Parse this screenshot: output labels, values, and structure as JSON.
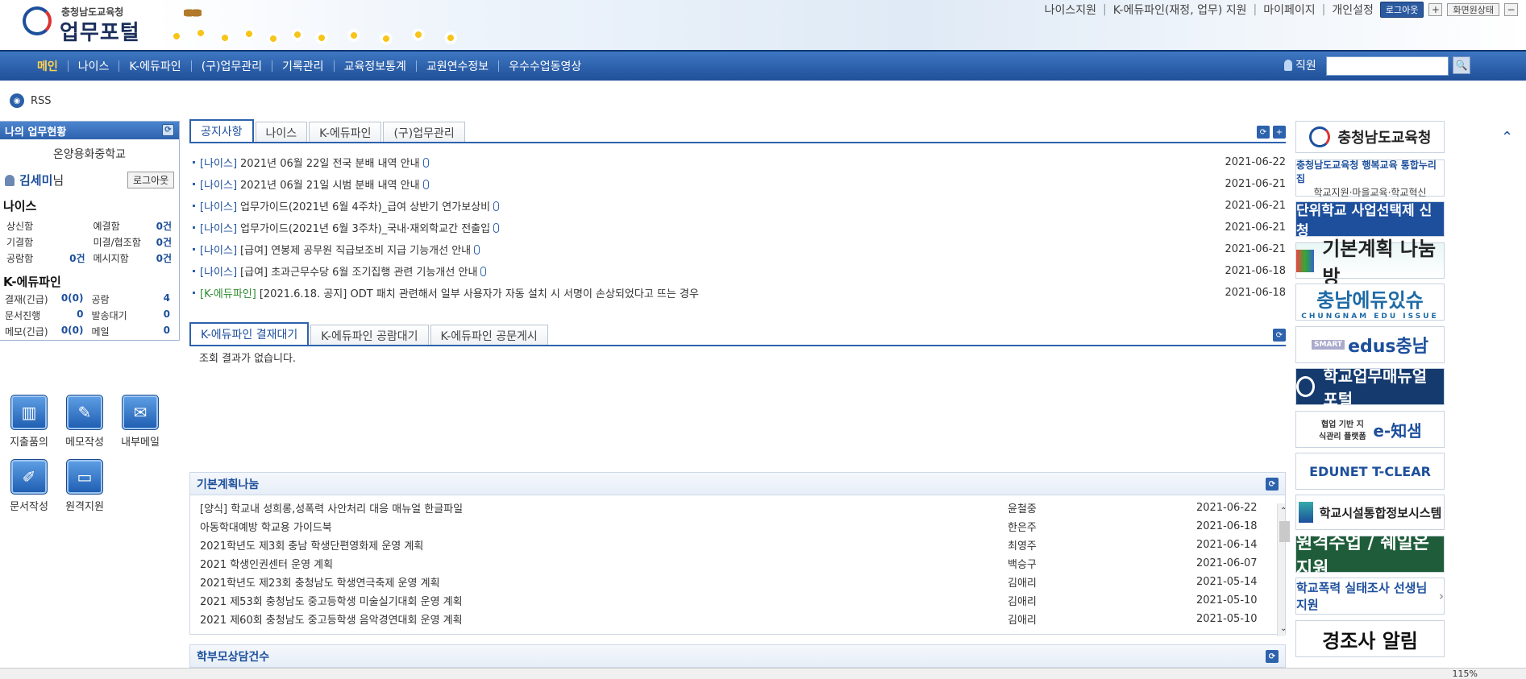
{
  "header": {
    "logo_sub": "충청남도교육청",
    "logo_main": "업무포털",
    "top_links": [
      "나이스지원",
      "K-에듀파인(재정, 업무) 지원",
      "마이페이지",
      "개인설정"
    ],
    "login_button": "로그아웃",
    "plus_button": "+",
    "screen_button": "화면원상태",
    "minus_button": "−"
  },
  "nav": {
    "items": [
      "메인",
      "나이스",
      "K-에듀파인",
      "(구)업무관리",
      "기록관리",
      "교육정보통계",
      "교원연수정보",
      "우수수업동영상"
    ],
    "employee_label": "직원",
    "search_placeholder": "",
    "search_go": "🔍"
  },
  "rss": {
    "label": "RSS"
  },
  "left": {
    "title": "나의 업무현황",
    "school": "온양용화중학교",
    "user_name": "김세미",
    "user_suffix": "님",
    "logout": "로그아웃",
    "neis_title": "나이스",
    "neis_stats": [
      {
        "label": "상신함",
        "value": ""
      },
      {
        "label": "예결함",
        "value": "0건"
      },
      {
        "label": "기결함",
        "value": ""
      },
      {
        "label": "미결/협조함",
        "value": "0건"
      },
      {
        "label": "공람함",
        "value": "0건"
      },
      {
        "label": "메시지함",
        "value": "0건"
      }
    ],
    "edufine_title": "K-에듀파인",
    "edufine_stats": [
      {
        "label": "결재(긴급)",
        "value": "0(0)"
      },
      {
        "label": "공람",
        "value": "4"
      },
      {
        "label": "문서진행",
        "value": "0"
      },
      {
        "label": "발송대기",
        "value": "0"
      },
      {
        "label": "메모(긴급)",
        "value": "0(0)"
      },
      {
        "label": "메일",
        "value": "0"
      }
    ],
    "quick_icons": [
      {
        "label": "지출품의",
        "icon": "chart-icon"
      },
      {
        "label": "메모작성",
        "icon": "pencil-icon"
      },
      {
        "label": "내부메일",
        "icon": "mail-icon"
      },
      {
        "label": "문서작성",
        "icon": "document-icon"
      },
      {
        "label": "원격지원",
        "icon": "monitor-icon"
      }
    ]
  },
  "notice": {
    "tabs": [
      "공지사항",
      "나이스",
      "K-에듀파인",
      "(구)업무관리"
    ],
    "rows": [
      {
        "cat": "[나이스]",
        "title": "2021년 06월 22일 전국 분배 내역 안내",
        "date": "2021-06-22",
        "attach": true
      },
      {
        "cat": "[나이스]",
        "title": "2021년 06월 21일 시범 분배 내역 안내",
        "date": "2021-06-21",
        "attach": true
      },
      {
        "cat": "[나이스]",
        "title": "업무가이드(2021년 6월 4주차)_급여 상반기 연가보상비",
        "date": "2021-06-21",
        "attach": true
      },
      {
        "cat": "[나이스]",
        "title": "업무가이드(2021년 6월 3주차)_국내·재외학교간 전출입",
        "date": "2021-06-21",
        "attach": true
      },
      {
        "cat": "[나이스]",
        "title": "[급여] 연봉제 공무원 직급보조비 지급 기능개선 안내",
        "date": "2021-06-21",
        "attach": true
      },
      {
        "cat": "[나이스]",
        "title": "[급여] 초과근무수당 6월 조기집행 관련 기능개선 안내",
        "date": "2021-06-18",
        "attach": true
      },
      {
        "cat": "[K-에듀파인]",
        "title": "[2021.6.18. 공지] ODT 패치 관련해서 일부 사용자가 자동 설치 시 서명이 손상되었다고 뜨는 경우",
        "date": "2021-06-18",
        "attach": false
      }
    ]
  },
  "edufine_box": {
    "tabs": [
      "K-에듀파인 결재대기",
      "K-에듀파인 공람대기",
      "K-에듀파인 공문게시"
    ],
    "empty": "조회 결과가 없습니다."
  },
  "plan": {
    "title": "기본계획나눔",
    "rows": [
      {
        "title": "[양식] 학교내 성희롱,성폭력 사안처리 대응 매뉴얼 한글파일",
        "author": "윤철중",
        "date": "2021-06-22"
      },
      {
        "title": "아동학대예방 학교용 가이드북",
        "author": "한은주",
        "date": "2021-06-18"
      },
      {
        "title": "2021학년도 제3회 충남 학생단편영화제 운영 계획",
        "author": "최영주",
        "date": "2021-06-14"
      },
      {
        "title": "2021 학생인권센터 운영 계획",
        "author": "백승구",
        "date": "2021-06-07"
      },
      {
        "title": "2021학년도 제23회 충청남도 학생연극축제 운영 계획",
        "author": "김애리",
        "date": "2021-05-14"
      },
      {
        "title": "2021 제53회 충청남도 중고등학생 미술실기대회 운영 계획",
        "author": "김애리",
        "date": "2021-05-10"
      },
      {
        "title": "2021 제60회 충청남도 중고등학생 음악경연대회 운영 계획",
        "author": "김애리",
        "date": "2021-05-10"
      }
    ]
  },
  "bottom_panel": {
    "title": "학부모상담건수"
  },
  "banners": [
    {
      "text": "충청남도교육청"
    },
    {
      "text": "충청남도교육청 행복교육 통합누리집",
      "sub": "학교지원·마을교육·학교혁신"
    },
    {
      "text": "단위학교 사업선택제 신청"
    },
    {
      "text": "기본계획 나눔방"
    },
    {
      "text": "충남에듀있슈",
      "sub": "CHUNGNAM EDU ISSUE"
    },
    {
      "text": "edus충남",
      "sub": "SMART"
    },
    {
      "text": "학교업무매뉴얼 포털"
    },
    {
      "text": "e-知샘",
      "sub": "협업 기반 지식관리 플랫폼"
    },
    {
      "text": "EDUNET T-CLEAR"
    },
    {
      "text": "학교시설통합정보시스템"
    },
    {
      "text": "원격수업 / 쉐일온 지원"
    },
    {
      "text": "학교폭력 실태조사 선생님 지원"
    },
    {
      "text": "경조사 알림"
    }
  ],
  "status": {
    "zoom": "115%"
  }
}
